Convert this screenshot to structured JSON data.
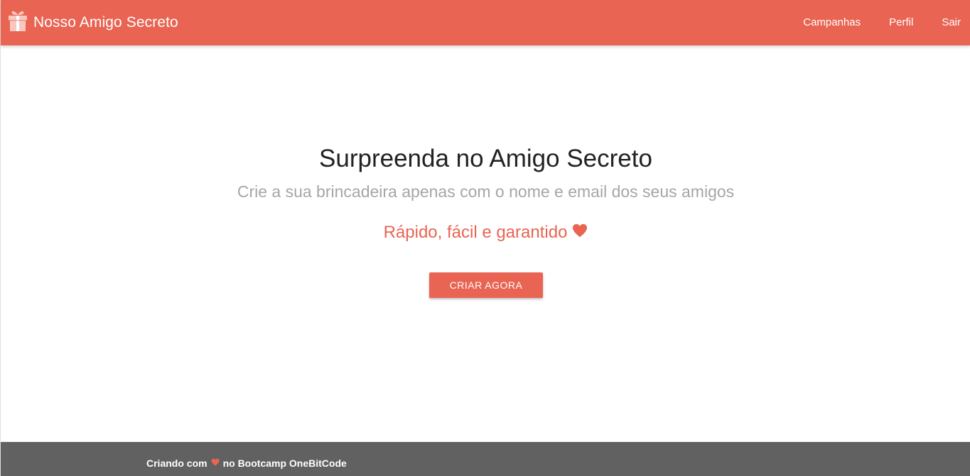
{
  "navbar": {
    "brand_icon": "gift-icon",
    "brand_label": "Nosso Amigo Secreto",
    "links": [
      {
        "label": "Campanhas"
      },
      {
        "label": "Perfil"
      },
      {
        "label": "Sair"
      }
    ]
  },
  "hero": {
    "title": "Surpreenda no Amigo Secreto",
    "subtitle": "Crie a sua brincadeira apenas com o nome e email dos seus amigos",
    "tagline": "Rápido, fácil e garantido",
    "tagline_icon": "heart-icon",
    "cta_label": "CRIAR AGORA"
  },
  "footer": {
    "text_before": "Criando com",
    "icon": "heart-icon",
    "text_after": "no Bootcamp OneBitCode"
  },
  "colors": {
    "primary": "#e96452",
    "footer_bg": "#616161",
    "subtitle": "#a6a6a6"
  }
}
